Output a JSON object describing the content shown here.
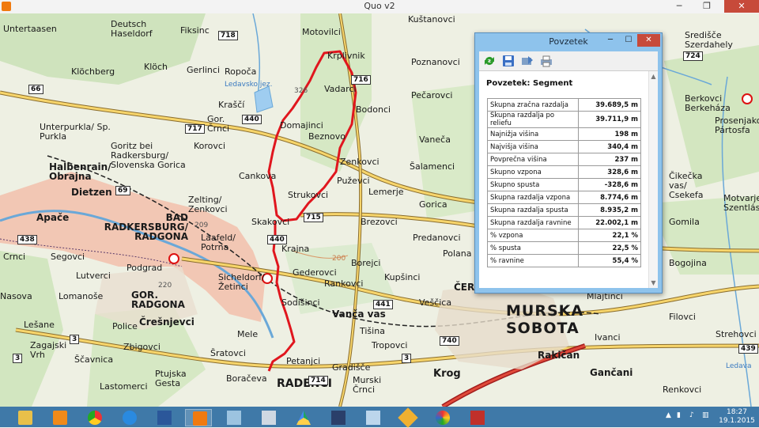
{
  "window": {
    "title": "Quo v2",
    "minimize": "─",
    "maximize": "❐",
    "close": "✕"
  },
  "map": {
    "place_labels": [
      "Untertaasen",
      "Deutsch Haseldorf",
      "Fiksinc",
      "Motovilci",
      "Kuštanovci",
      "Središče Szerdahely",
      "Klöchberg",
      "Klöch",
      "Gerlinci",
      "Ropoča",
      "Krplivnik",
      "Poznanovci",
      "Vadarci",
      "Pečarovci",
      "Kraščí",
      "Gor. Črnci",
      "Domajinci",
      "Bodonci",
      "Unterpurkla/ Sp. Purkla",
      "Korovci",
      "Beznovo",
      "Vaneča",
      "Goritz bei Radkersburg/ Slovenska Gorica",
      "Halbenrain/ Obrajna",
      "Dietzen",
      "Zenkovci",
      "Šalamenci",
      "Cankova",
      "Puževci",
      "Lemerje",
      "Zelting/ Zenkovci",
      "Strukovci",
      "Gorica",
      "Apače",
      "BAD RADKERSBURG/ RADGONA",
      "Skakovci",
      "Brezovci",
      "Laafeld/ Potrna",
      "Predanovci",
      "Krajna",
      "Polana",
      "Crnci",
      "Segovci",
      "Borejci",
      "Podgrad",
      "Gederovci",
      "Kupšinci",
      "Lutverci",
      "Sicheldorf/ Žetinci",
      "Rankovci",
      "Nasova",
      "Lomanoše",
      "GOR. RADGONA",
      "Sodišinci",
      "Vanča vas",
      "Veščica",
      "Črešnjevci",
      "Lešane",
      "Police",
      "Mele",
      "Tišina",
      "Tropovci",
      "Zagajski Vrh",
      "Ščavnica",
      "Zbigovci",
      "Šratovci",
      "Petanjci",
      "Gradišče",
      "Ptujska Gesta",
      "Boračeva",
      "Murski Črnci",
      "Lastomerci",
      "RADENCI",
      "Krog",
      "Bogojina",
      "Filovci",
      "Mlajtinci",
      "Ivanci",
      "Rakičan",
      "Gančani",
      "Strehovci",
      "Renkovci",
      "Čikečka vas/ Csekefa",
      "Motvarjevci Szentlász",
      "Gomila",
      "Berkovci Berkeháza",
      "Prosenjakovci Pártosfa",
      "Ledava",
      "Ledavsko jez."
    ],
    "cities": [
      "MURSKA",
      "SOBOTA",
      "ČERNEL",
      "RAKIČAN",
      "GANČANI"
    ],
    "road_numbers": [
      "718",
      "724",
      "716",
      "66",
      "440",
      "717",
      "69",
      "715",
      "438",
      "440",
      "220",
      "209",
      "441",
      "3",
      "740",
      "3",
      "3",
      "714",
      "439"
    ],
    "spot_heights": [
      "326",
      "209",
      "220",
      "200"
    ]
  },
  "dialog": {
    "title": "Povzetek",
    "heading": "Povzetek: Segment",
    "rows": [
      {
        "label": "Skupna zračna razdalja",
        "value": "39.689,5 m"
      },
      {
        "label": "Skupna razdalja po reliefu",
        "value": "39.711,9 m"
      },
      {
        "label": "Najnižja višina",
        "value": "198 m"
      },
      {
        "label": "Najvišja višina",
        "value": "340,4 m"
      },
      {
        "label": "Povprečna višina",
        "value": "237 m"
      },
      {
        "label": "Skupno vzpona",
        "value": "328,6 m"
      },
      {
        "label": "Skupno spusta",
        "value": "-328,6 m"
      },
      {
        "label": "Skupna razdalja vzpona",
        "value": "8.774,6 m"
      },
      {
        "label": "Skupna razdalja spusta",
        "value": "8.935,2 m"
      },
      {
        "label": "Skupna razdalja ravnine",
        "value": "22.002,1 m"
      },
      {
        "label": "% vzpona",
        "value": "22,1 %"
      },
      {
        "label": "% spusta",
        "value": "22,5 %"
      },
      {
        "label": "% ravnine",
        "value": "55,4 %"
      }
    ],
    "toolbar_icons": [
      "refresh-icon",
      "save-icon",
      "export-icon",
      "print-icon"
    ]
  },
  "taskbar": {
    "apps": [
      "file-explorer",
      "outlook",
      "chrome",
      "internet-explorer",
      "word",
      "quo",
      "paint-3d",
      "calculator",
      "google-drive",
      "network-tool",
      "image-viewer",
      "pen-tool",
      "paint",
      "misc-tool"
    ],
    "clock_time": "18:27",
    "clock_date": "19.1.2015"
  },
  "colors": {
    "route": "#e0161e",
    "accent": "#3f79a8",
    "dialog_frame": "#8ec3ec"
  }
}
